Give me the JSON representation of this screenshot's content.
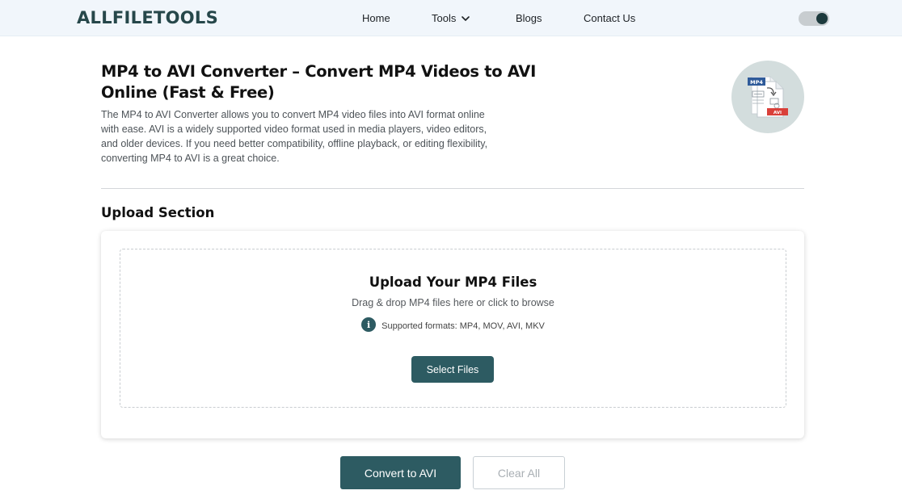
{
  "brand": {
    "logo_text": "ALLFILETOOLS"
  },
  "nav": {
    "home": "Home",
    "tools": "Tools",
    "blogs": "Blogs",
    "contact": "Contact Us",
    "theme_toggle": "dark-mode-toggle"
  },
  "hero": {
    "title": "MP4 to AVI Converter – Convert MP4 Videos to AVI Online (Fast & Free)",
    "description": "The MP4 to AVI Converter allows you to convert MP4 video files into AVI format online with ease. AVI is a widely supported video format used in media players, video editors, and older devices. If you need better compatibility, offline playback, or editing flexibility, converting MP4 to AVI is a great choice.",
    "illustration": {
      "source_badge": "MP4",
      "target_badge": "AVI"
    }
  },
  "upload": {
    "section_title": "Upload Section",
    "title": "Upload Your MP4 Files",
    "subtitle": "Drag & drop MP4 files here or click to browse",
    "formats": "Supported formats: MP4, MOV, AVI, MKV",
    "select_button": "Select Files"
  },
  "actions": {
    "convert_button": "Convert to AVI",
    "clear_button": "Clear All"
  },
  "colors": {
    "brand": "#26474a",
    "primary": "#2d5b62",
    "nav_bg": "#f1f6fb",
    "avi_red": "#d9403a",
    "mp4_blue": "#2f5b9a"
  }
}
